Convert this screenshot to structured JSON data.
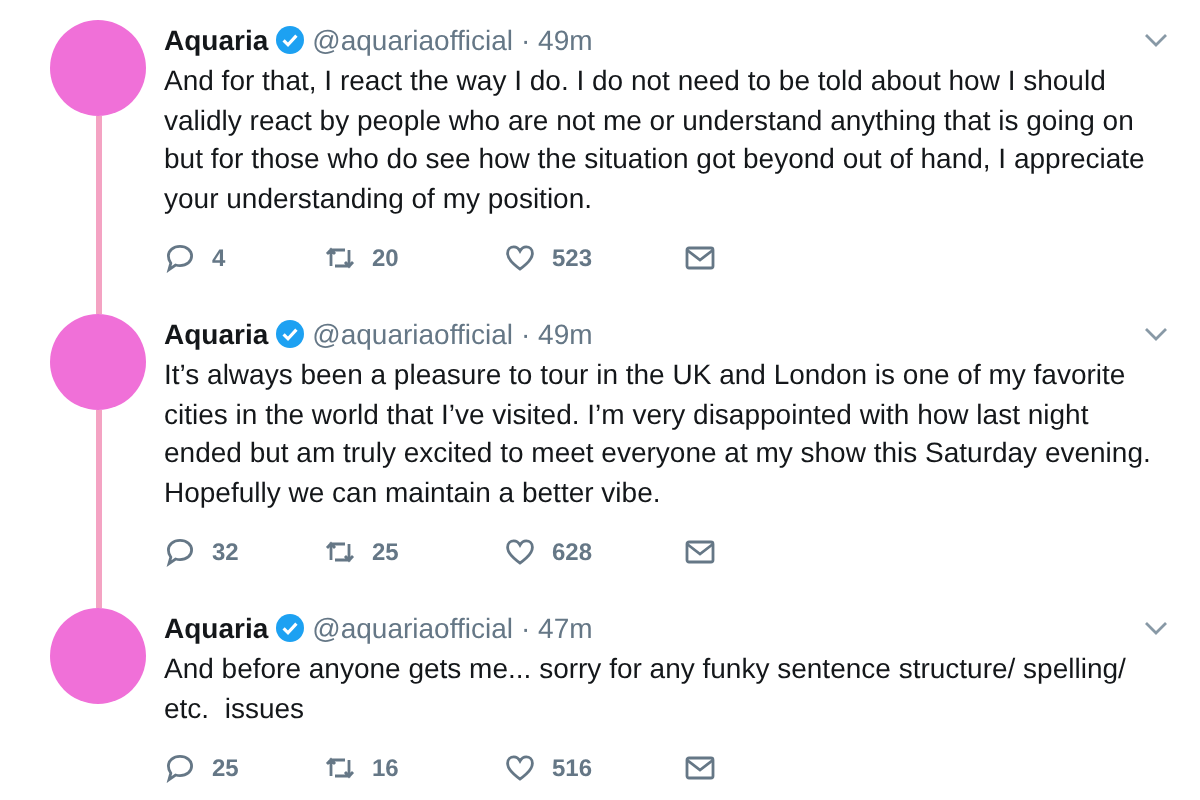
{
  "tweets": [
    {
      "name": "Aquaria",
      "verified": true,
      "handle": "@aquariaofficial",
      "time": "· 49m",
      "text": "And for that, I react the way I do. I do not need to be told about how I should validly react by people who are not me or understand anything that is going on but for those who do see how the situation got beyond out of hand, I appreciate your understanding of my position.",
      "replies": "4",
      "retweets": "20",
      "likes": "523"
    },
    {
      "name": "Aquaria",
      "verified": true,
      "handle": "@aquariaofficial",
      "time": "· 49m",
      "text": "It’s always been a pleasure to tour in the UK and London is one of my favorite cities in the world that I’ve visited. I’m very disappointed with how last night ended but am truly excited to meet everyone at my show this Saturday evening. Hopefully we can maintain a better vibe.",
      "replies": "32",
      "retweets": "25",
      "likes": "628"
    },
    {
      "name": "Aquaria",
      "verified": true,
      "handle": "@aquariaofficial",
      "time": "· 47m",
      "text": "And before anyone gets me... sorry for any funky sentence structure/ spelling/ etc.  issues",
      "replies": "25",
      "retweets": "16",
      "likes": "516"
    }
  ]
}
